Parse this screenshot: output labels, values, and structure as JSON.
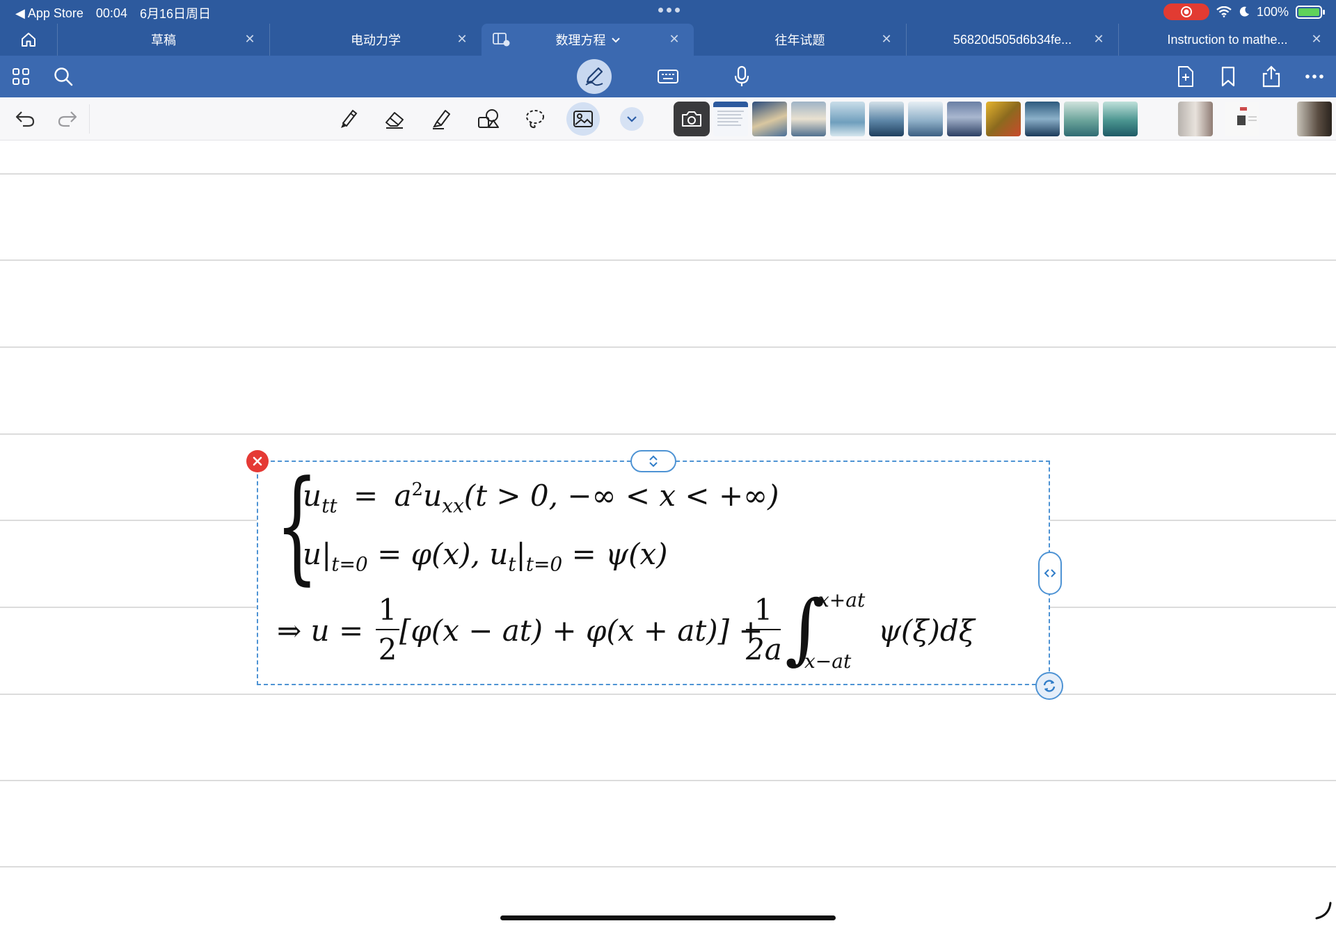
{
  "status_bar": {
    "back_app": "◀ App Store",
    "time": "00:04",
    "date": "6月16日周日",
    "battery": "100%"
  },
  "tabs": [
    {
      "label": "草稿",
      "active": false
    },
    {
      "label": "电动力学",
      "active": false
    },
    {
      "label": "数理方程",
      "active": true
    },
    {
      "label": "往年试题",
      "active": false
    },
    {
      "label": "56820d505d6b34fe...",
      "active": false
    },
    {
      "label": "Instruction to mathe...",
      "active": false
    }
  ],
  "colors": {
    "tab_bar": "#2d5a9e",
    "toolbar": "#3b69b0",
    "selection": "#4e93d4",
    "delete": "#e53a35"
  },
  "toolbar": {
    "left_icons": [
      "grid-icon",
      "search-icon"
    ],
    "center_icons": [
      "pen-mode-icon",
      "keyboard-icon",
      "microphone-icon"
    ],
    "right_icons": [
      "new-page-icon",
      "bookmark-icon",
      "share-icon",
      "more-icon"
    ]
  },
  "tools": [
    "undo-icon",
    "redo-icon",
    "pen-icon",
    "eraser-icon",
    "highlighter-icon",
    "shapes-icon",
    "lasso-icon",
    "image-icon",
    "chevron-down-icon"
  ],
  "equation": {
    "line1": {
      "lhs": "u",
      "lhs_sub": "tt",
      "eq": "=",
      "a": "a",
      "sup": "2",
      "u": "u",
      "u_sub": "xx",
      "cond": "(t > 0, −∞ < x < +∞)"
    },
    "line2": {
      "u": "u",
      "bar_sub": "t=0",
      "mid": "= φ(x), u",
      "t_sub": "t",
      "bar_sub2": "t=0",
      "rhs": "= ψ(x)"
    },
    "line3": {
      "arrow": "⇒ u =",
      "half_num": "1",
      "half_den": "2",
      "bracket": "[φ(x − at) + φ(x + at)] +",
      "frac2_num": "1",
      "frac2_den": "2a",
      "int_upper": "x+at",
      "int_lower": "x−at",
      "integrand": "ψ(ξ)dξ"
    }
  }
}
